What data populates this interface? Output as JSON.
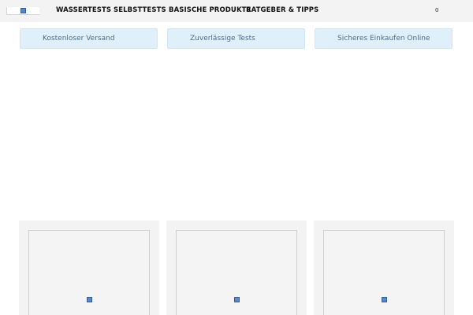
{
  "header": {
    "logo_icon": "broken-image-icon",
    "nav": [
      {
        "label": "WASSERTESTS"
      },
      {
        "label": "SELBSTTESTS"
      },
      {
        "label": "BASISCHE PRODUKTE"
      },
      {
        "label": "RATGEBER & TIPPS"
      }
    ],
    "cart_count": "0"
  },
  "features": [
    {
      "label": "Kostenloser Versand"
    },
    {
      "label": "Zuverlässige Tests"
    },
    {
      "label": "Sicheres Einkaufen Online"
    }
  ],
  "products": [
    {
      "image_icon": "broken-image-icon"
    },
    {
      "image_icon": "broken-image-icon"
    },
    {
      "image_icon": "broken-image-icon"
    }
  ],
  "colors": {
    "header_bg": "#f3f3f3",
    "feature_bg": "#dff0fa",
    "feature_text": "#4d6b86",
    "card_bg": "#f3f3f3"
  }
}
